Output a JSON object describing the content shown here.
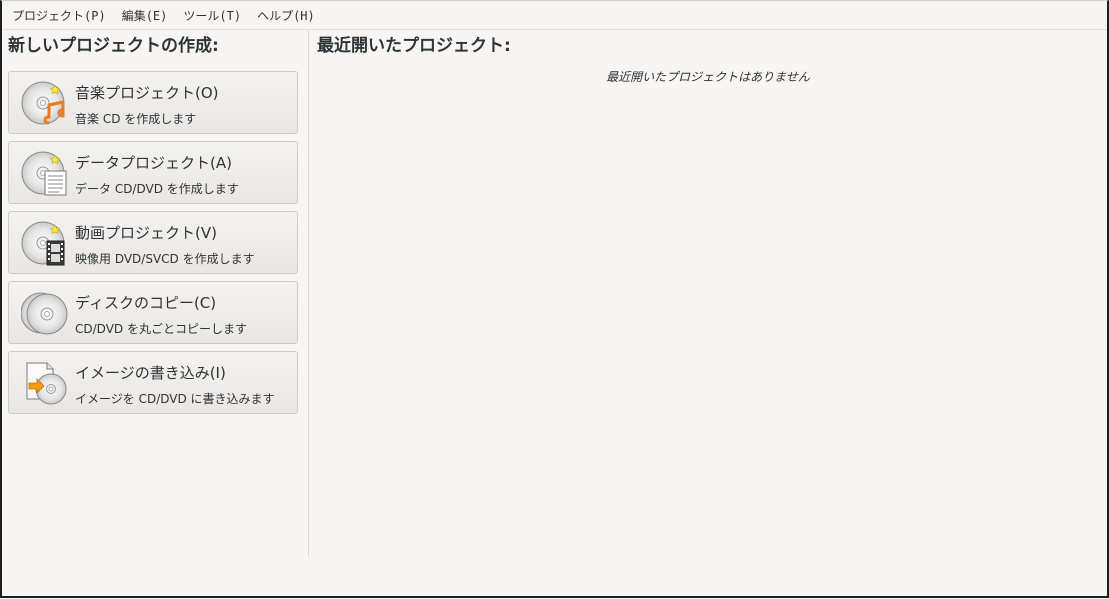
{
  "menubar": {
    "items": [
      {
        "label": "プロジェクト(P)"
      },
      {
        "label": "編集(E)"
      },
      {
        "label": "ツール(T)"
      },
      {
        "label": "ヘルプ(H)"
      }
    ]
  },
  "left_pane": {
    "title": "新しいプロジェクトの作成:",
    "buttons": [
      {
        "title": "音楽プロジェクト(O)",
        "desc": "音楽 CD を作成します",
        "icon": "audio-disc-icon"
      },
      {
        "title": "データプロジェクト(A)",
        "desc": "データ CD/DVD を作成します",
        "icon": "data-disc-icon"
      },
      {
        "title": "動画プロジェクト(V)",
        "desc": "映像用 DVD/SVCD を作成します",
        "icon": "video-disc-icon"
      },
      {
        "title": "ディスクのコピー(C)",
        "desc": "CD/DVD を丸ごとコピーします",
        "icon": "disc-copy-icon"
      },
      {
        "title": "イメージの書き込み(I)",
        "desc": "イメージを CD/DVD に書き込みます",
        "icon": "burn-image-icon"
      }
    ]
  },
  "right_pane": {
    "title": "最近開いたプロジェクト:",
    "empty_message": "最近開いたプロジェクトはありません"
  },
  "colors": {
    "background": "#f6f5f4",
    "text": "#2e3436",
    "border": "#cfcbc5",
    "accent_orange": "#f39c12"
  }
}
